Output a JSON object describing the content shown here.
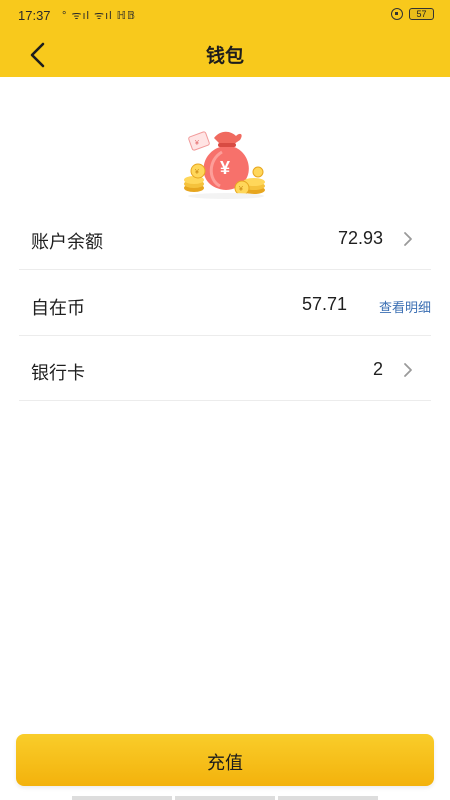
{
  "status_bar": {
    "time": "17:37",
    "signal_text": "° ᯤıl ᯤıl ℍ𝔹",
    "battery_level": "57"
  },
  "navbar": {
    "title": "钱包"
  },
  "wallet_rows": [
    {
      "label": "账户余额",
      "value": "72.93",
      "action": "chevron-right-icon"
    },
    {
      "label": "自在币",
      "value": "57.71",
      "link": "查看明细"
    },
    {
      "label": "银行卡",
      "value": "2",
      "action": "chevron-right-icon"
    }
  ],
  "bottom_button": {
    "label": "充值"
  },
  "colors": {
    "brand_yellow": "#f8c91c",
    "button_gradient_top": "#f9cd2a",
    "button_gradient_bottom": "#f3b20c",
    "link_blue": "#3b6fb3",
    "divider": "#ececec"
  }
}
